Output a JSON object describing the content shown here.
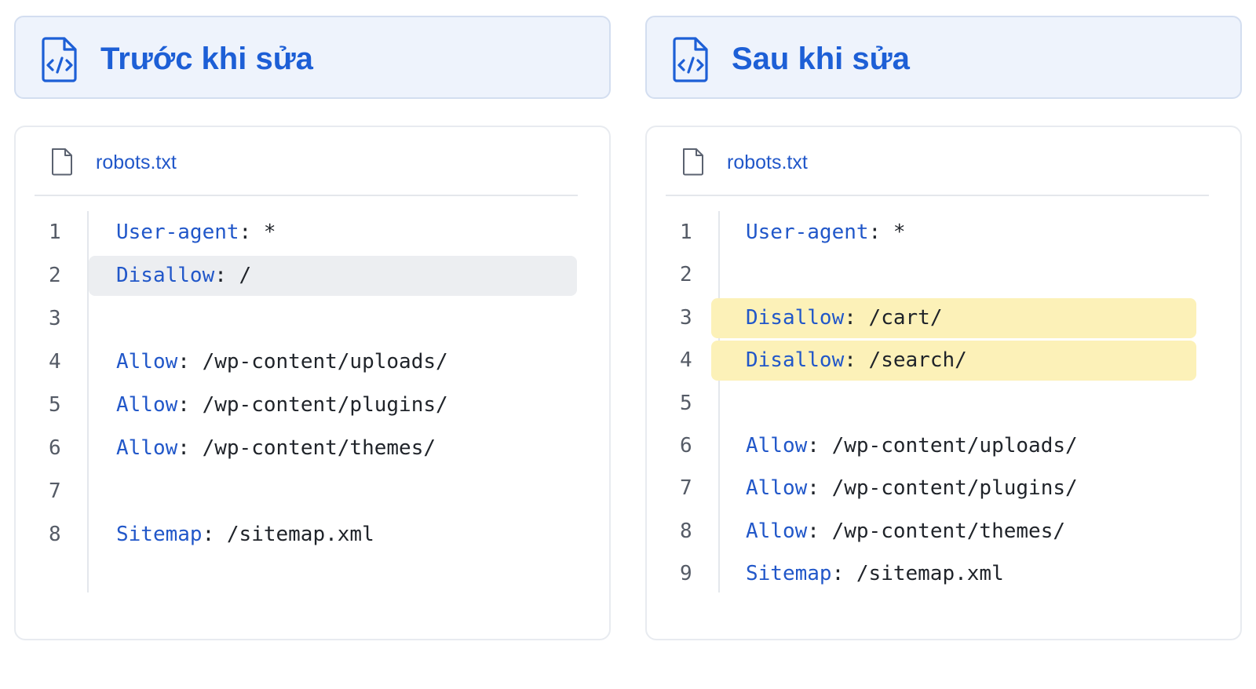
{
  "panels": [
    {
      "title": "Trước khi sửa",
      "file_name": "robots.txt",
      "lines": [
        {
          "num": "1",
          "key": "User-agent",
          "sep": ": ",
          "value": "*",
          "highlight": false
        },
        {
          "num": "2",
          "key": "Disallow",
          "sep": ": ",
          "value": "/",
          "highlight": true
        },
        {
          "num": "3",
          "key": "",
          "sep": "",
          "value": "",
          "highlight": false
        },
        {
          "num": "4",
          "key": "Allow",
          "sep": ": ",
          "value": "/wp-content/uploads/",
          "highlight": false
        },
        {
          "num": "5",
          "key": "Allow",
          "sep": ": ",
          "value": "/wp-content/plugins/",
          "highlight": false
        },
        {
          "num": "6",
          "key": "Allow",
          "sep": ": ",
          "value": "/wp-content/themes/",
          "highlight": false
        },
        {
          "num": "7",
          "key": "",
          "sep": "",
          "value": "",
          "highlight": false
        },
        {
          "num": "8",
          "key": "Sitemap",
          "sep": ": ",
          "value": "/sitemap.xml",
          "highlight": false
        }
      ]
    },
    {
      "title": "Sau khi sửa",
      "file_name": "robots.txt",
      "lines": [
        {
          "num": "1",
          "key": "User-agent",
          "sep": ": ",
          "value": "*",
          "highlight": false
        },
        {
          "num": "2",
          "key": "",
          "sep": "",
          "value": "",
          "highlight": false
        },
        {
          "num": "3",
          "key": "Disallow",
          "sep": ": ",
          "value": "/cart/",
          "highlight": true
        },
        {
          "num": "4",
          "key": "Disallow",
          "sep": ": ",
          "value": "/search/",
          "highlight": true
        },
        {
          "num": "5",
          "key": "",
          "sep": "",
          "value": "",
          "highlight": false
        },
        {
          "num": "6",
          "key": "Allow",
          "sep": ": ",
          "value": "/wp-content/uploads/",
          "highlight": false
        },
        {
          "num": "7",
          "key": "Allow",
          "sep": ": ",
          "value": "/wp-content/plugins/",
          "highlight": false
        },
        {
          "num": "8",
          "key": "Allow",
          "sep": ": ",
          "value": "/wp-content/themes/",
          "highlight": false
        },
        {
          "num": "9",
          "key": "Sitemap",
          "sep": ": ",
          "value": "/sitemap.xml",
          "highlight": false
        }
      ]
    }
  ],
  "colors": {
    "accent": "#1d5fd6",
    "keyword": "#2157c9",
    "header_bg": "#eef3fc",
    "removed_highlight": "#eceef1",
    "added_highlight": "#fcf1b8"
  },
  "icons": {
    "header": "code-file-icon",
    "file": "document-icon"
  }
}
